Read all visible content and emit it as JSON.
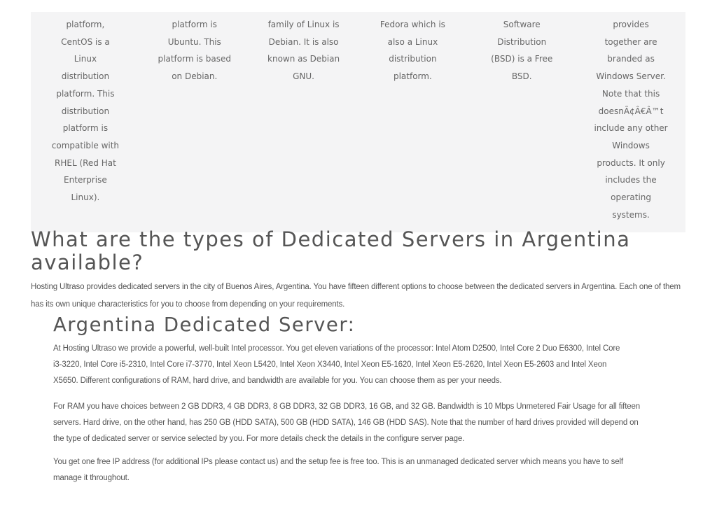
{
  "os_table": {
    "columns": [
      {
        "lines": [
          "platform,",
          "CentOS is a",
          "Linux",
          "distribution",
          "platform. This",
          "distribution",
          "platform is",
          "compatible with",
          "RHEL (Red Hat",
          "Enterprise",
          "Linux)."
        ]
      },
      {
        "lines": [
          "platform is",
          "Ubuntu. This",
          "platform is based",
          "on Debian."
        ]
      },
      {
        "lines": [
          "family of Linux is",
          "Debian. It is also",
          "known as Debian",
          "GNU."
        ]
      },
      {
        "lines": [
          "Fedora which is",
          "also a Linux",
          "distribution",
          "platform."
        ]
      },
      {
        "lines": [
          "Software",
          "Distribution",
          "(BSD) is a Free",
          "BSD."
        ]
      },
      {
        "lines": [
          "provides",
          "together are",
          "branded as",
          "Windows Server.",
          "Note that this",
          "doesnÃ¢Â€Â™t",
          "include any other",
          "Windows",
          "products. It only",
          "includes the",
          "operating",
          "systems."
        ]
      }
    ]
  },
  "main_heading": "What are the types of Dedicated Servers in Argentina available?",
  "intro_text": "Hosting Ultraso provides dedicated servers in the city of Buenos Aires, Argentina. You have fifteen different options to choose between the dedicated servers in Argentina. Each one of them has its own unique characteristics for you to choose from depending on your requirements.",
  "sub_heading": "Argentina Dedicated Server:",
  "paragraphs": [
    {
      "lines": [
        "At Hosting Ultraso we provide a powerful, well-built Intel processor. You get eleven variations of the processor: Intel Atom D2500, Intel Core 2 Duo E6300, Intel Core",
        "i3-3220, Intel Core i5-2310, Intel Core i7-3770, Intel Xeon L5420, Intel Xeon X3440, Intel Xeon E5-1620, Intel Xeon E5-2620, Intel Xeon E5-2603 and Intel Xeon",
        "X5650. Different configurations of RAM, hard drive, and bandwidth are available for you. You can choose them as per your needs."
      ]
    },
    {
      "lines": [
        "For RAM you have choices between 2 GB DDR3, 4 GB DDR3, 8 GB DDR3, 32 GB DDR3, 16 GB, and 32 GB. Bandwidth is 10 Mbps Unmetered Fair Usage for all fifteen",
        "servers. Hard drive, on the other hand, has 250 GB (HDD SATA), 500 GB (HDD SATA), 146 GB (HDD SAS). Note that the number of hard drives provided will depend on",
        "the type of dedicated server or service selected by you. For more details check the details in the configure server page."
      ]
    },
    {
      "lines": [
        "You get one free IP address (for additional IPs please contact us) and the setup fee is free too. This is an unmanaged dedicated server which means you have to self",
        "manage it throughout."
      ]
    }
  ]
}
